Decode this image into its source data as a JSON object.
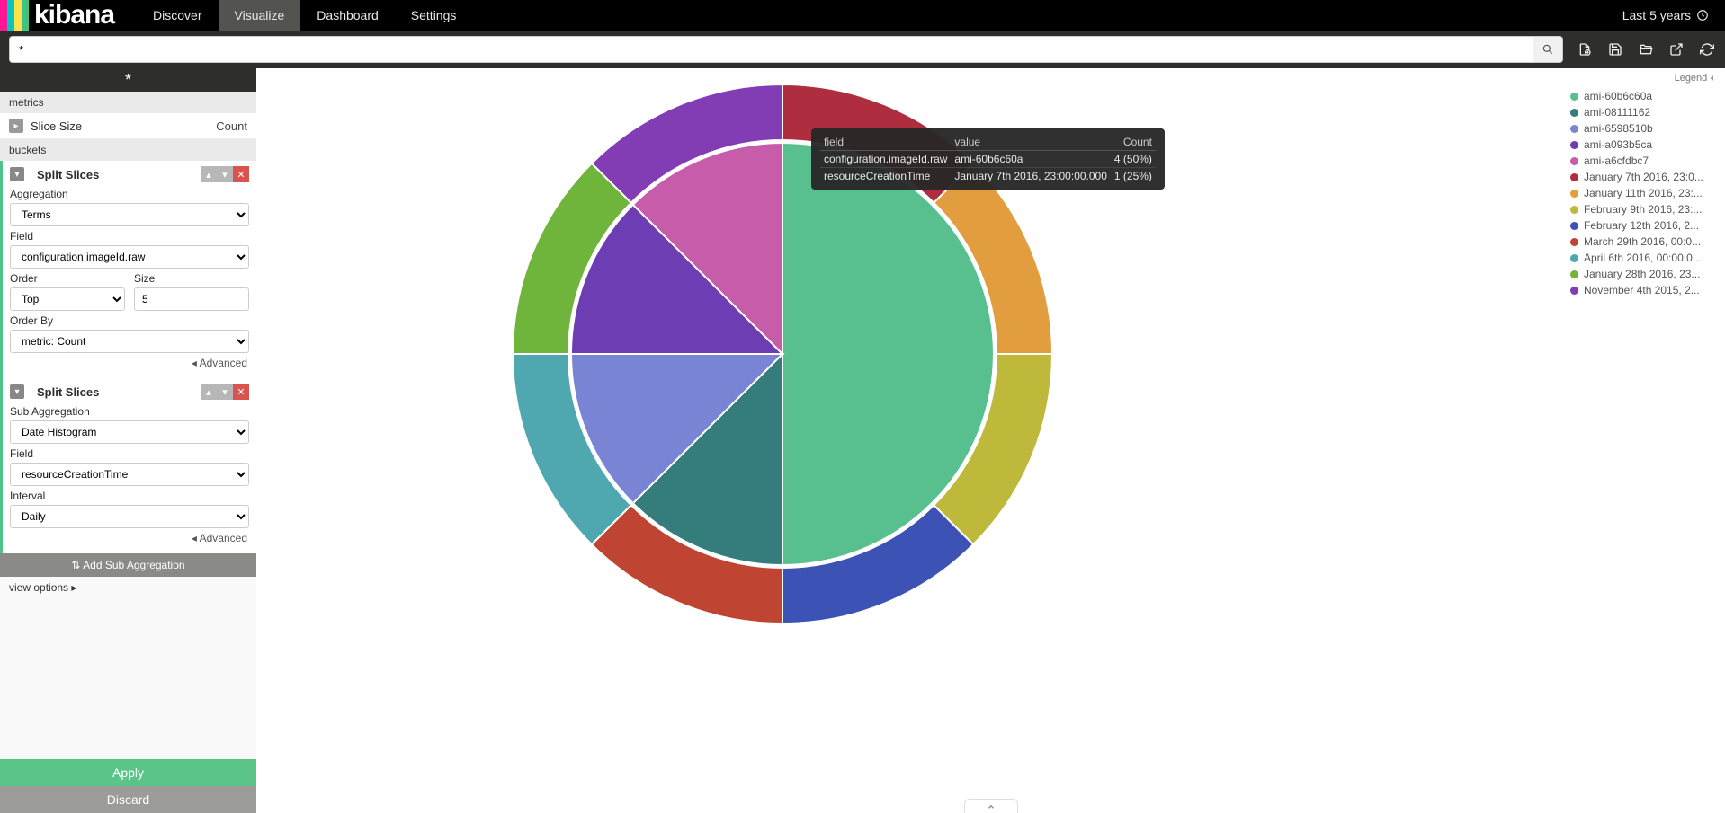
{
  "nav": {
    "logo": "kibana",
    "links": [
      "Discover",
      "Visualize",
      "Dashboard",
      "Settings"
    ],
    "active": 1,
    "time_label": "Last 5 years"
  },
  "search": {
    "query": "*"
  },
  "side": {
    "tab_placeholder": "*",
    "section_metrics": "metrics",
    "slice_size_label": "Slice Size",
    "slice_size_value": "Count",
    "section_buckets": "buckets",
    "bucket1": {
      "title": "Split Slices",
      "agg_label": "Aggregation",
      "agg_value": "Terms",
      "field_label": "Field",
      "field_value": "configuration.imageId.raw",
      "order_label": "Order",
      "order_value": "Top",
      "size_label": "Size",
      "size_value": "5",
      "orderby_label": "Order By",
      "orderby_value": "metric: Count",
      "advanced": "Advanced"
    },
    "bucket2": {
      "title": "Split Slices",
      "subagg_label": "Sub Aggregation",
      "subagg_value": "Date Histogram",
      "field_label": "Field",
      "field_value": "resourceCreationTime",
      "interval_label": "Interval",
      "interval_value": "Daily",
      "advanced": "Advanced"
    },
    "add_sub": "Add Sub Aggregation",
    "view_options": "view options",
    "apply": "Apply",
    "discard": "Discard"
  },
  "tooltip": {
    "h_field": "field",
    "h_value": "value",
    "h_count": "Count",
    "r1_field": "configuration.imageId.raw",
    "r1_value": "ami-60b6c60a",
    "r1_count": "4 (50%)",
    "r2_field": "resourceCreationTime",
    "r2_value": "January 7th 2016, 23:00:00.000",
    "r2_count": "1 (25%)"
  },
  "legend": {
    "title": "Legend",
    "items": [
      {
        "label": "ami-60b6c60a",
        "color": "#58bf8f"
      },
      {
        "label": "ami-08111162",
        "color": "#347d7c"
      },
      {
        "label": "ami-6598510b",
        "color": "#7a84d4"
      },
      {
        "label": "ami-a093b5ca",
        "color": "#6d3db3"
      },
      {
        "label": "ami-a6cfdbc7",
        "color": "#c75caa"
      },
      {
        "label": "January 7th 2016, 23:0...",
        "color": "#ae2d3f"
      },
      {
        "label": "January 11th 2016, 23:...",
        "color": "#e29d3f"
      },
      {
        "label": "February 9th 2016, 23:...",
        "color": "#beb93a"
      },
      {
        "label": "February 12th 2016, 2...",
        "color": "#3c52b4"
      },
      {
        "label": "March 29th 2016, 00:0...",
        "color": "#bf4432"
      },
      {
        "label": "April 6th 2016, 00:00:0...",
        "color": "#4fa8af"
      },
      {
        "label": "January 28th 2016, 23...",
        "color": "#6fb53c"
      },
      {
        "label": "November 4th 2015, 2...",
        "color": "#823cb4"
      }
    ]
  },
  "chart_data": {
    "type": "pie",
    "title": "",
    "rings": 2,
    "inner": {
      "field": "configuration.imageId.raw",
      "slices": [
        {
          "label": "ami-60b6c60a",
          "value": 4,
          "pct": 50,
          "color": "#58bf8f"
        },
        {
          "label": "ami-08111162",
          "value": 1,
          "pct": 12.5,
          "color": "#347d7c"
        },
        {
          "label": "ami-6598510b",
          "value": 1,
          "pct": 12.5,
          "color": "#7a84d4"
        },
        {
          "label": "ami-a093b5ca",
          "value": 1,
          "pct": 12.5,
          "color": "#6d3db3"
        },
        {
          "label": "ami-a6cfdbc7",
          "value": 1,
          "pct": 12.5,
          "color": "#c75caa"
        }
      ]
    },
    "outer": {
      "field": "resourceCreationTime",
      "slices": [
        {
          "parent": "ami-60b6c60a",
          "label": "January 7th 2016, 23:00:00.000",
          "value": 1,
          "pct": 12.5,
          "color": "#ae2d3f"
        },
        {
          "parent": "ami-60b6c60a",
          "label": "January 11th 2016, 23:...",
          "value": 1,
          "pct": 12.5,
          "color": "#e29d3f"
        },
        {
          "parent": "ami-60b6c60a",
          "label": "February 9th 2016, 23:...",
          "value": 1,
          "pct": 12.5,
          "color": "#beb93a"
        },
        {
          "parent": "ami-60b6c60a",
          "label": "February 12th 2016, 2...",
          "value": 1,
          "pct": 12.5,
          "color": "#3c52b4"
        },
        {
          "parent": "ami-08111162",
          "label": "March 29th 2016, 00:0...",
          "value": 1,
          "pct": 12.5,
          "color": "#bf4432"
        },
        {
          "parent": "ami-6598510b",
          "label": "April 6th 2016, 00:00:0...",
          "value": 1,
          "pct": 12.5,
          "color": "#4fa8af"
        },
        {
          "parent": "ami-a093b5ca",
          "label": "January 28th 2016, 23...",
          "value": 1,
          "pct": 12.5,
          "color": "#6fb53c"
        },
        {
          "parent": "ami-a6cfdbc7",
          "label": "November 4th 2015, 2...",
          "value": 1,
          "pct": 12.5,
          "color": "#823cb4"
        }
      ]
    }
  }
}
